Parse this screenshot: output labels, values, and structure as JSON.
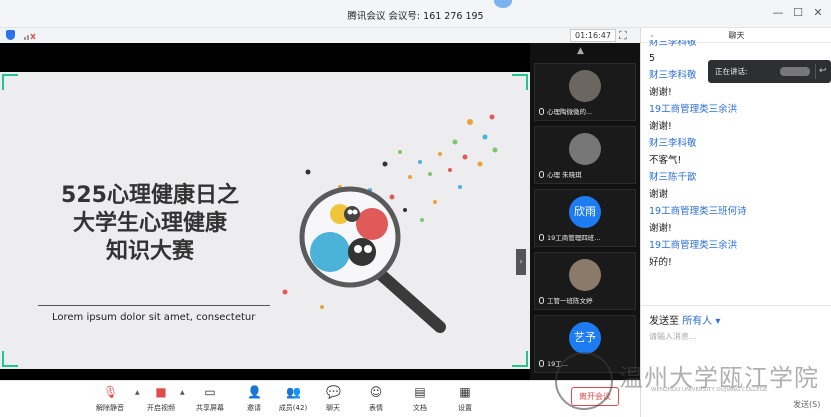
{
  "window": {
    "title": "腾讯会议 会议号: 161 276 195",
    "minimize": "—",
    "maximize": "☐",
    "close": "✕"
  },
  "meeting": {
    "timer": "01:16:47"
  },
  "slide": {
    "title_lines": [
      "525心理健康日之",
      "大学生心理健康",
      "知识大赛"
    ],
    "subtitle": "Lorem ipsum dolor sit amet, consectetur"
  },
  "participants": [
    {
      "name": "心理陶微微的...",
      "avatar_text": ""
    },
    {
      "name": "心理 朱晓琪",
      "avatar_text": ""
    },
    {
      "name": "19工商管理四班...",
      "avatar_text": "欣雨"
    },
    {
      "name": "工管一班陈文婷",
      "avatar_text": ""
    },
    {
      "name": "19工...",
      "avatar_text": "艺予"
    }
  ],
  "toolbar": {
    "unmute": "解除静音",
    "video": "开启视频",
    "share": "共享屏幕",
    "invite": "邀请",
    "members": "成员(42)",
    "chat": "聊天",
    "emoji": "表情",
    "docs": "文档",
    "settings": "设置",
    "leave": "离开会议"
  },
  "chat": {
    "title": "聊天",
    "speaking_label": "正在讲话:",
    "messages": [
      {
        "sender": "财三李科敬",
        "text": "5"
      },
      {
        "sender": "财三李科敬",
        "text": "谢谢!"
      },
      {
        "sender": "19工商管理类三余洪",
        "text": "谢谢!"
      },
      {
        "sender": "财三李科敬",
        "text": "不客气!"
      },
      {
        "sender": "财三陈千歆",
        "text": "谢谢"
      },
      {
        "sender": "19工商管理类三班何诗",
        "text": "谢谢!"
      },
      {
        "sender": "19工商管理类三余洪",
        "text": "好的!"
      }
    ],
    "send_to_label": "发送至",
    "send_to_target": "所有人",
    "input_placeholder": "请输入消息...",
    "send_button": "发送(S)"
  },
  "watermark": {
    "text": "温州大学瓯江学院",
    "english": "WENZHOU UNIVERSITY OUJIANG COLLEGE"
  },
  "colors": {
    "accent": "#2a6fd6",
    "leave": "#e24b4b",
    "frame": "#22c58b"
  }
}
